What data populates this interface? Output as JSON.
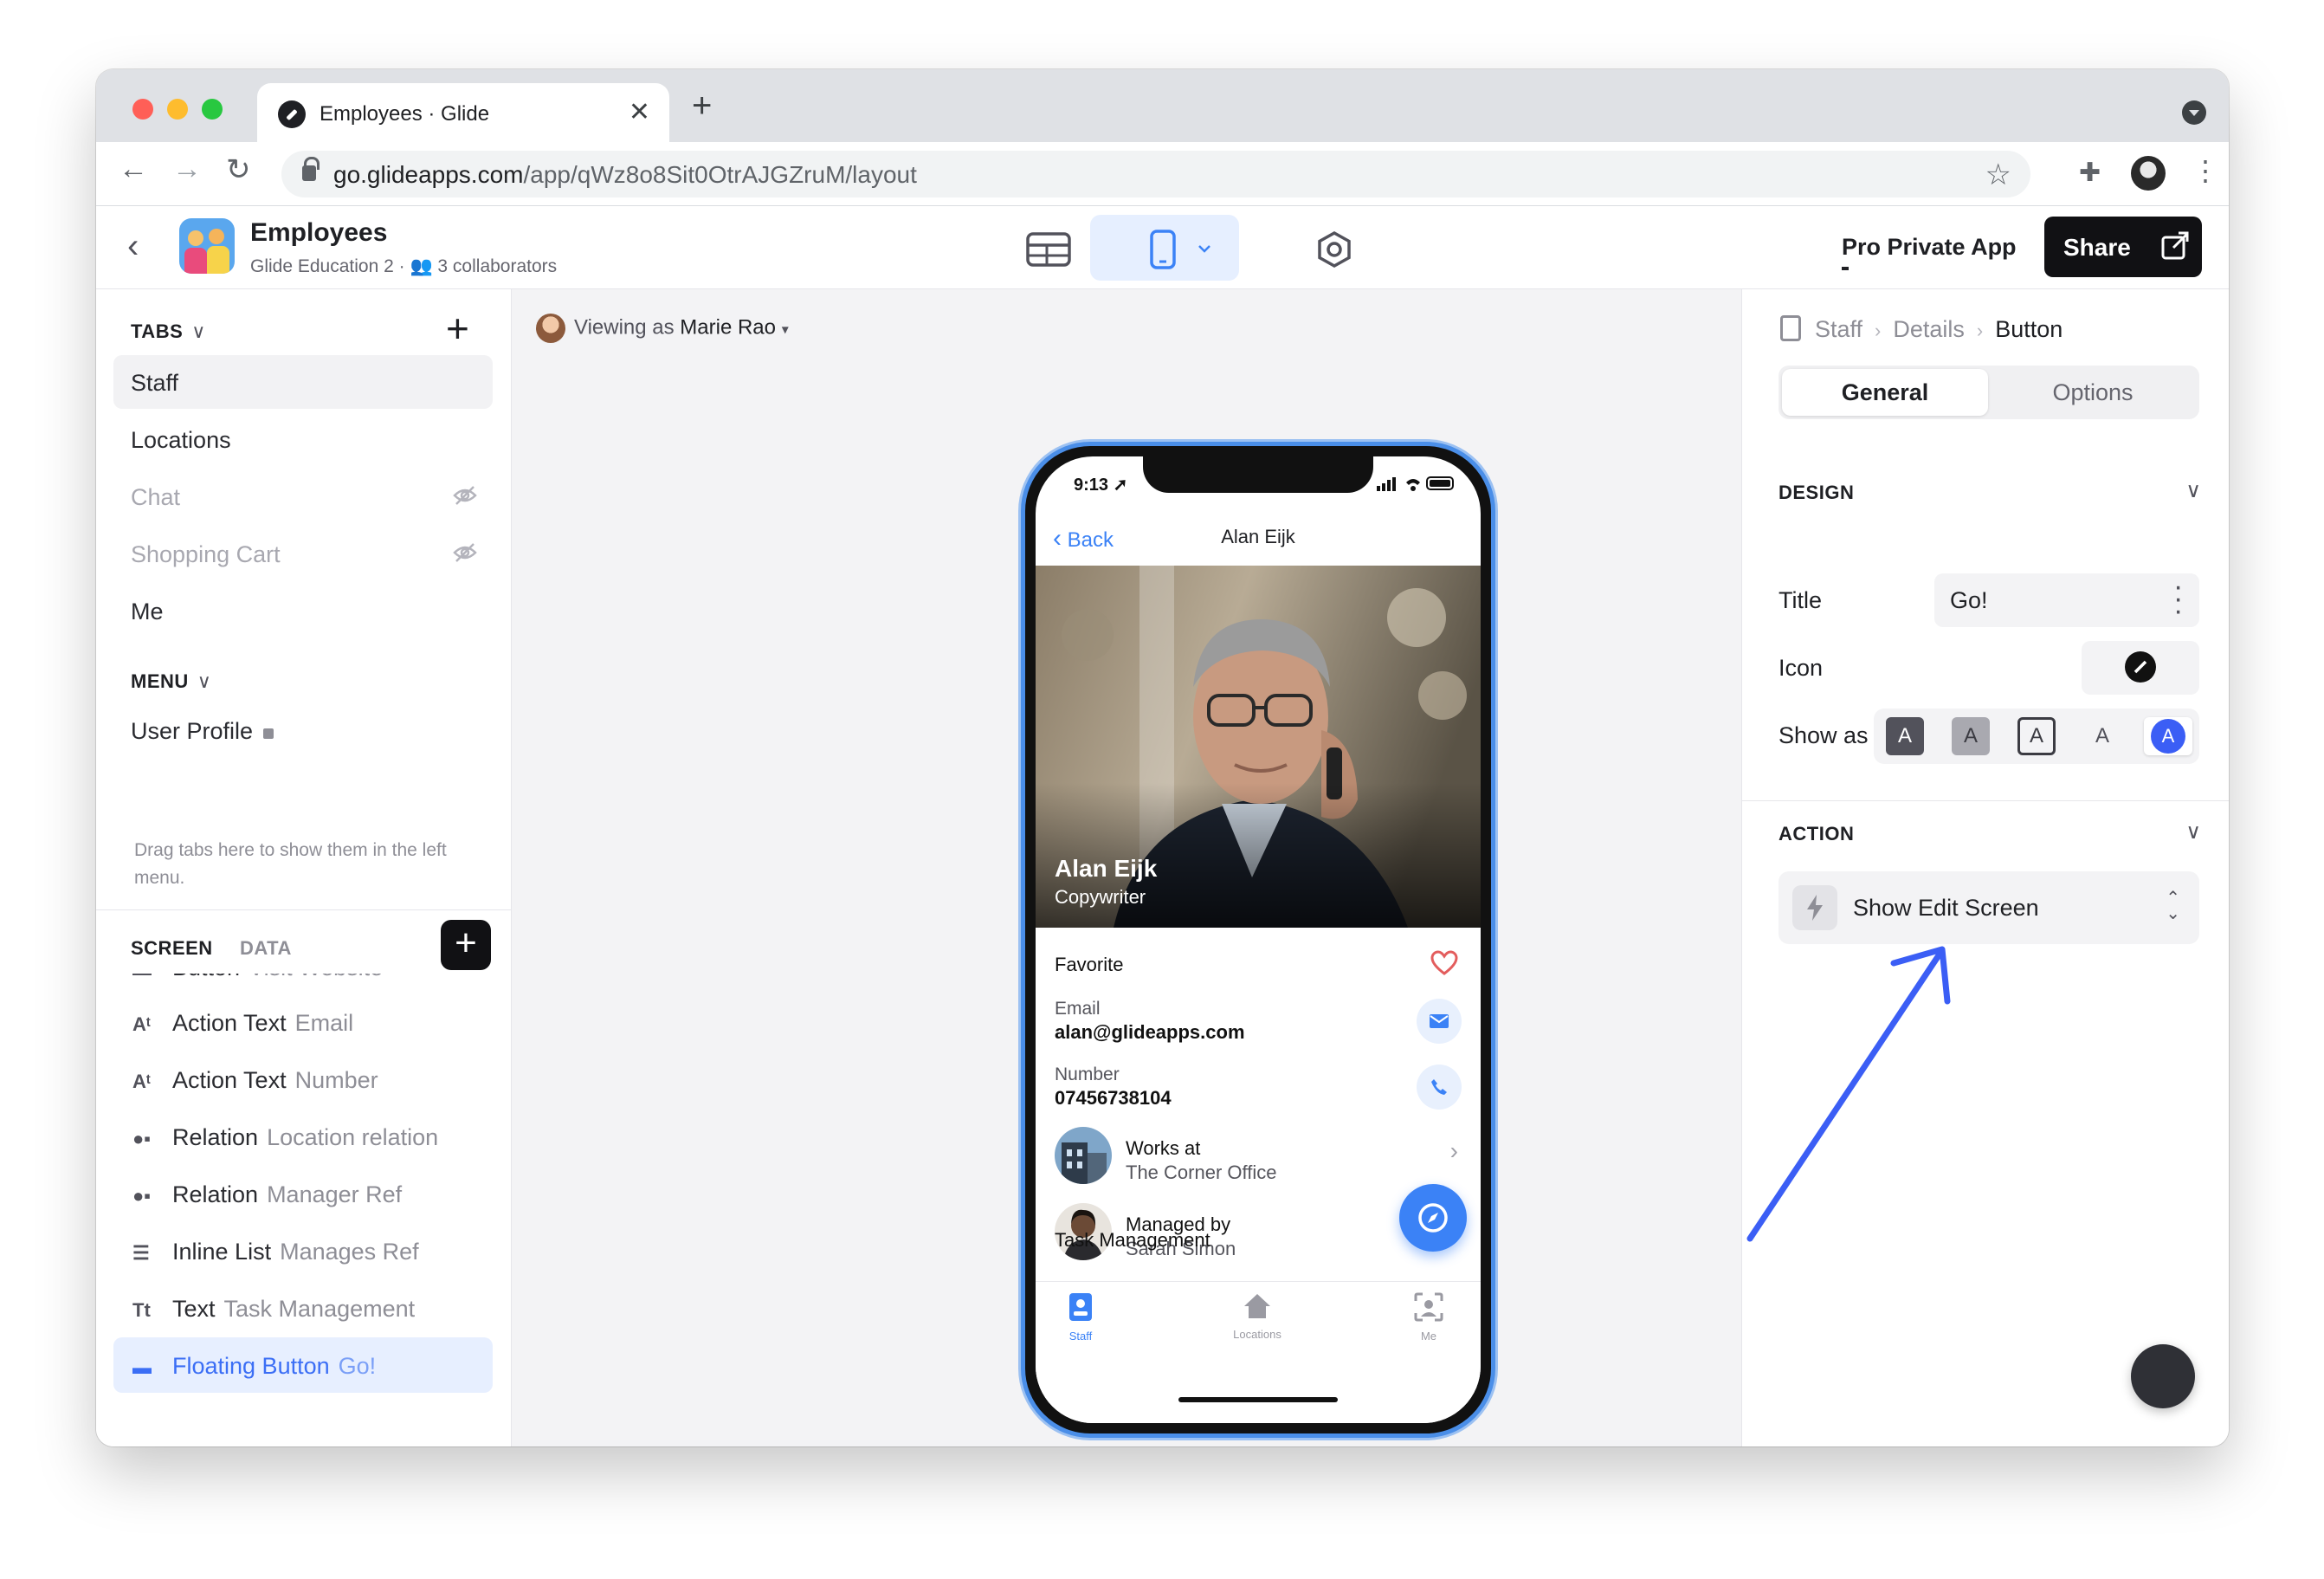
{
  "browser": {
    "tab_title": "Employees · Glide",
    "url_host": "go.glideapps.com",
    "url_path": "/app/qWz8o8Sit0OtrAJGZruM/layout"
  },
  "app": {
    "name": "Employees",
    "subtitle": "Glide Education 2 · ",
    "collaborators": "3 collaborators",
    "plan_label": "Pro Private App",
    "share_label": "Share"
  },
  "left": {
    "tabs_header": "TABS",
    "tabs": [
      {
        "label": "Staff",
        "active": true
      },
      {
        "label": "Locations"
      },
      {
        "label": "Chat",
        "hidden": true
      },
      {
        "label": "Shopping Cart",
        "hidden": true
      },
      {
        "label": "Me"
      }
    ],
    "menu_header": "MENU",
    "menu_items": [
      {
        "label": "User Profile"
      }
    ],
    "menu_hint": "Drag tabs here to show them in the left menu.",
    "screen_tab": "SCREEN",
    "data_tab": "DATA",
    "components": [
      {
        "icon": "At",
        "name": "Button",
        "sub": "Visit Website"
      },
      {
        "icon": "At",
        "name": "Action Text",
        "sub": "Email"
      },
      {
        "icon": "At",
        "name": "Action Text",
        "sub": "Number"
      },
      {
        "icon": "relation-icon",
        "name": "Relation",
        "sub": "Location relation"
      },
      {
        "icon": "relation-icon",
        "name": "Relation",
        "sub": "Manager Ref"
      },
      {
        "icon": "list-icon",
        "name": "Inline List",
        "sub": "Manages Ref"
      },
      {
        "icon": "Tt",
        "name": "Text",
        "sub": "Task Management"
      },
      {
        "icon": "floating-button-icon",
        "name": "Floating Button",
        "sub": "Go!",
        "selected": true
      }
    ]
  },
  "canvas": {
    "viewing_prefix": "Viewing as ",
    "viewing_user": "Marie Rao"
  },
  "phone": {
    "time": "9:13",
    "back_label": "Back",
    "nav_title": "Alan Eijk",
    "hero_name": "Alan Eijk",
    "hero_role": "Copywriter",
    "favorite_label": "Favorite",
    "email_label": "Email",
    "email_value": "alan@glideapps.com",
    "number_label": "Number",
    "number_value": "07456738104",
    "works_label": "Works at",
    "works_value": "The Corner Office",
    "managed_label": "Managed by",
    "managed_value": "Sarah Simon",
    "task_label": "Task Management",
    "tabbar": [
      {
        "label": "Staff",
        "active": true
      },
      {
        "label": "Locations"
      },
      {
        "label": "Me"
      }
    ]
  },
  "right": {
    "crumbs": [
      "Staff",
      "Details",
      "Button"
    ],
    "seg_general": "General",
    "seg_options": "Options",
    "design_header": "DESIGN",
    "title_label": "Title",
    "title_value": "Go!",
    "icon_label": "Icon",
    "show_as_label": "Show as",
    "show_as_glyph": "A",
    "action_header": "ACTION",
    "action_value": "Show Edit Screen"
  },
  "colors": {
    "accent": "#3b82f6",
    "selected_bg": "#e7efff",
    "annotation_arrow": "#3b5ef5"
  }
}
